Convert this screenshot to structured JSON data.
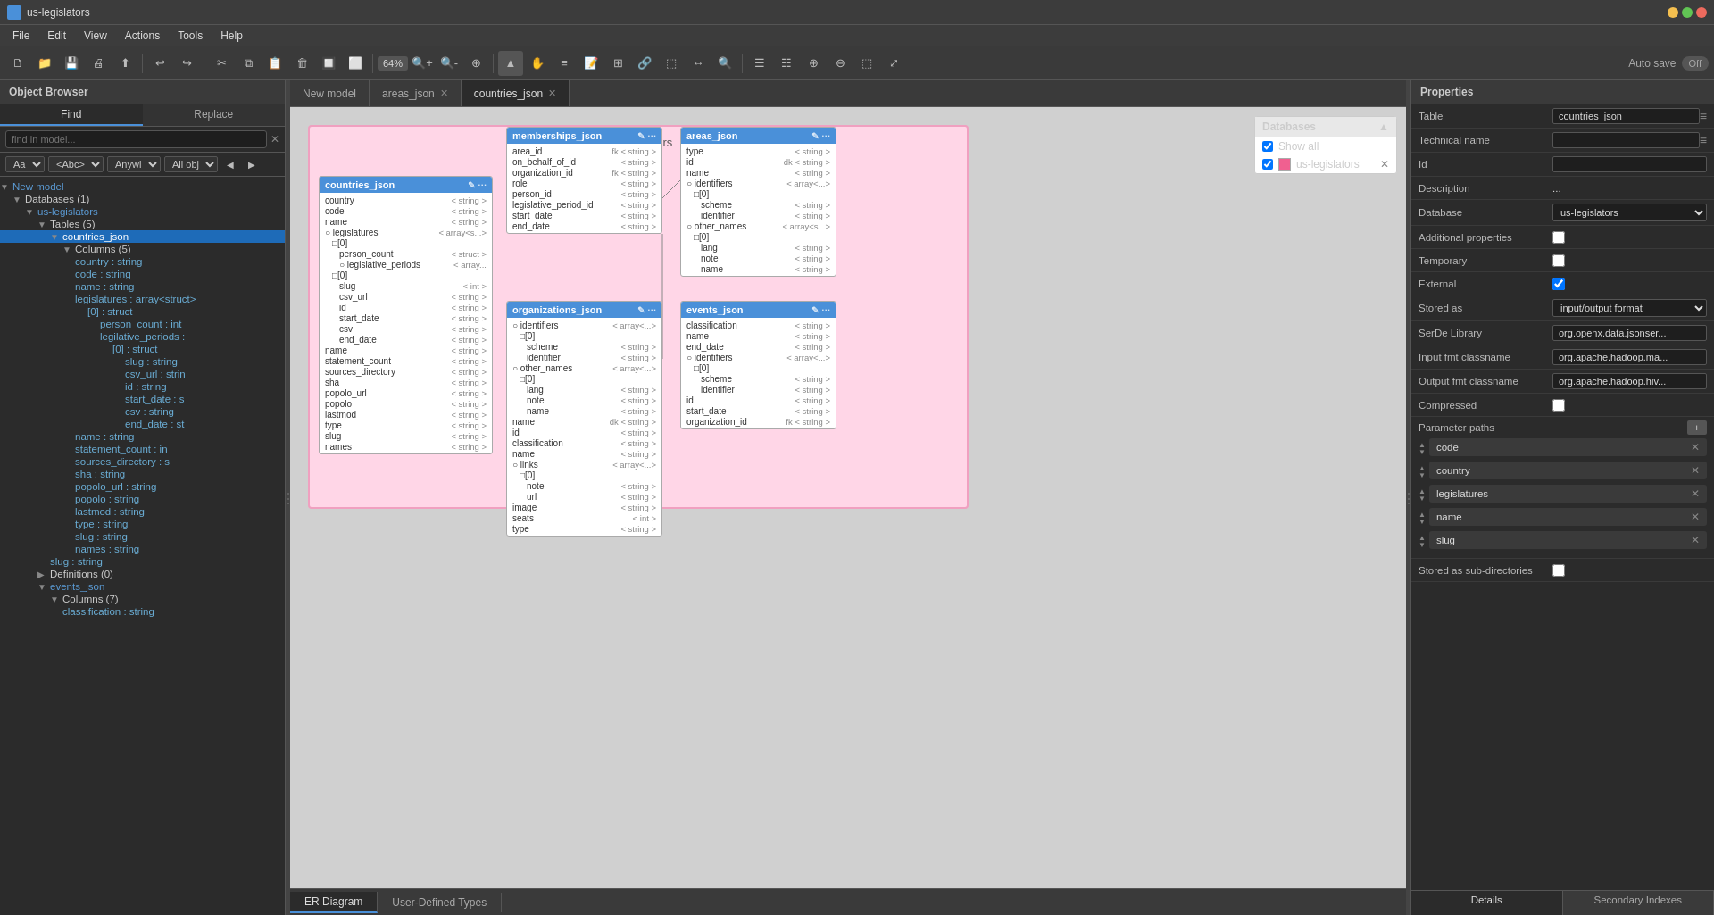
{
  "titlebar": {
    "title": "us-legislators"
  },
  "menubar": {
    "items": [
      "File",
      "Edit",
      "View",
      "Actions",
      "Tools",
      "Help"
    ]
  },
  "toolbar": {
    "zoom": "64%",
    "autosave_label": "Auto save",
    "toggle_label": "Off"
  },
  "left_panel": {
    "title": "Object Browser",
    "find_tab": "Find",
    "replace_tab": "Replace",
    "search_placeholder": "find in model...",
    "filter_case": "Aa",
    "filter_abc": "<Abc>",
    "filter_anywl": "Anywl ▼",
    "filter_allobj": "All obj ▼",
    "tree": {
      "new_model": "New model",
      "databases": "Databases (1)",
      "us_legislators": "us-legislators",
      "tables": "Tables (5)",
      "countries_json": "countries_json",
      "columns": "Columns (5)",
      "cols": [
        "country : string",
        "code : string",
        "name : string",
        "legislatures : array<struct>",
        "[0] : struct",
        "person_count : int",
        "legilative_periods :",
        "[0] : struct",
        "slug : string",
        "csv_url : strin",
        "id : string",
        "start_date : s",
        "csv : string",
        "end_date : st",
        "name : string",
        "statement_count : in",
        "sources_directory : s",
        "sha : string",
        "popolo_url : string",
        "popolo : string",
        "lastmod : string",
        "type : string",
        "slug : string",
        "names : string"
      ],
      "slug_string": "slug : string",
      "definitions": "Definitions (0)",
      "events_json": "events_json",
      "events_cols": "Columns (7)",
      "classification_string": "classification : string"
    }
  },
  "tabs": [
    {
      "label": "New model",
      "active": false,
      "closable": false
    },
    {
      "label": "areas_json",
      "active": false,
      "closable": true
    },
    {
      "label": "countries_json",
      "active": true,
      "closable": true
    }
  ],
  "canvas": {
    "schema_title": "us-legislators",
    "tables": {
      "countries_json": {
        "title": "countries_json",
        "rows": [
          {
            "name": "country",
            "type": "< string >"
          },
          {
            "name": "code",
            "type": "< string >"
          },
          {
            "name": "name",
            "type": "< string >"
          },
          {
            "name": "○ legislatures",
            "type": "< array<s...>"
          },
          {
            "name": "  □[0]",
            "type": ""
          },
          {
            "name": "    person_count",
            "type": "< struct >"
          },
          {
            "name": "    ○ legislative_periods",
            "type": "< array<...>"
          },
          {
            "name": "      □[0]",
            "type": ""
          },
          {
            "name": "        slug",
            "type": "< int >"
          },
          {
            "name": "        csv_url",
            "type": "< string >"
          },
          {
            "name": "        id",
            "type": "< string >"
          },
          {
            "name": "        start_date",
            "type": "< string >"
          },
          {
            "name": "        csv",
            "type": "< string >"
          },
          {
            "name": "        end_date",
            "type": "< string >"
          },
          {
            "name": "name",
            "type": "< string >"
          },
          {
            "name": "statement_count",
            "type": "< string >"
          },
          {
            "name": "sources_directory",
            "type": "< string >"
          },
          {
            "name": "sha",
            "type": "< string >"
          },
          {
            "name": "popolo_url",
            "type": "< string >"
          },
          {
            "name": "popolo",
            "type": "< string >"
          },
          {
            "name": "lastmod",
            "type": "< string >"
          },
          {
            "name": "type",
            "type": "< string >"
          },
          {
            "name": "slug",
            "type": "< string >"
          },
          {
            "name": "names",
            "type": "< string >"
          }
        ]
      },
      "memberships_json": {
        "title": "memberships_json",
        "rows": [
          {
            "name": "area_id",
            "type": "fk  < string >"
          },
          {
            "name": "on_behalf_of_id",
            "type": "< string >"
          },
          {
            "name": "organization_id",
            "type": "fk  < string >"
          },
          {
            "name": "role",
            "type": "< string >"
          },
          {
            "name": "person_id",
            "type": "< string >"
          },
          {
            "name": "legislative_period_id",
            "type": "< string >"
          },
          {
            "name": "start_date",
            "type": "< string >"
          },
          {
            "name": "end_date",
            "type": "< string >"
          }
        ]
      },
      "areas_json": {
        "title": "areas_json",
        "rows": [
          {
            "name": "type",
            "type": "< string >"
          },
          {
            "name": "id",
            "type": "dk  < string >"
          },
          {
            "name": "name",
            "type": "< string >"
          },
          {
            "name": "○ identifiers",
            "type": "< array<...>"
          },
          {
            "name": "  □[0]",
            "type": ""
          },
          {
            "name": "    scheme",
            "type": "< string >"
          },
          {
            "name": "    identifier",
            "type": "< string >"
          },
          {
            "name": "○ other_names",
            "type": "< array<s...>"
          },
          {
            "name": "  □[0]",
            "type": ""
          },
          {
            "name": "    lang",
            "type": "< string >"
          },
          {
            "name": "    note",
            "type": "< string >"
          },
          {
            "name": "    name",
            "type": "< string >"
          }
        ]
      },
      "organizations_json": {
        "title": "organizations_json",
        "rows": [
          {
            "name": "○ identifiers",
            "type": "< array<...>"
          },
          {
            "name": "  □[0]",
            "type": ""
          },
          {
            "name": "    scheme",
            "type": "< string >"
          },
          {
            "name": "    identifier",
            "type": "< string >"
          },
          {
            "name": "○ other_names",
            "type": "< array<...>"
          },
          {
            "name": "  □[0]",
            "type": ""
          },
          {
            "name": "    lang",
            "type": "< string >"
          },
          {
            "name": "    note",
            "type": "< string >"
          },
          {
            "name": "    name",
            "type": "< string >"
          },
          {
            "name": "name",
            "type": "dk  < string >"
          },
          {
            "name": "id",
            "type": "< string >"
          },
          {
            "name": "classification",
            "type": "< string >"
          },
          {
            "name": "name",
            "type": "< string >"
          },
          {
            "name": "○ links",
            "type": "< array<...>"
          },
          {
            "name": "  □[0]",
            "type": ""
          },
          {
            "name": "    note",
            "type": "< string >"
          },
          {
            "name": "    url",
            "type": "< string >"
          },
          {
            "name": "image",
            "type": "< string >"
          },
          {
            "name": "seats",
            "type": "< int >"
          },
          {
            "name": "type",
            "type": "< string >"
          }
        ]
      },
      "events_json": {
        "title": "events_json",
        "rows": [
          {
            "name": "classification",
            "type": "< string >"
          },
          {
            "name": "name",
            "type": "< string >"
          },
          {
            "name": "end_date",
            "type": "< string >"
          },
          {
            "name": "○ identifiers",
            "type": "< array<...>"
          },
          {
            "name": "  □[0]",
            "type": ""
          },
          {
            "name": "    scheme",
            "type": "< string >"
          },
          {
            "name": "    identifier",
            "type": "< string >"
          },
          {
            "name": "id",
            "type": "< string >"
          },
          {
            "name": "start_date",
            "type": "< string >"
          },
          {
            "name": "organization_id",
            "type": "fk  < string >"
          }
        ]
      }
    },
    "bottom_tabs": [
      "ER Diagram",
      "User-Defined Types"
    ]
  },
  "databases_panel": {
    "title": "Databases",
    "show_all": "Show all",
    "items": [
      {
        "label": "us-legislators",
        "color": "#f06090",
        "checked": true
      }
    ]
  },
  "properties": {
    "title": "Properties",
    "fields": [
      {
        "label": "Table",
        "value": "countries_json",
        "type": "input"
      },
      {
        "label": "Technical name",
        "value": "",
        "type": "input"
      },
      {
        "label": "Id",
        "value": "",
        "type": "input"
      },
      {
        "label": "Description",
        "value": "...",
        "type": "text"
      },
      {
        "label": "Database",
        "value": "us-legislators",
        "type": "select"
      },
      {
        "label": "Additional properties",
        "value": "",
        "type": "checkbox",
        "checked": false
      },
      {
        "label": "Temporary",
        "value": "",
        "type": "checkbox",
        "checked": false
      },
      {
        "label": "External",
        "value": "",
        "type": "checkbox",
        "checked": true
      },
      {
        "label": "Stored as",
        "value": "input/output format",
        "type": "select"
      },
      {
        "label": "SerDe Library",
        "value": "org.openx.data.jsonser...",
        "type": "input"
      },
      {
        "label": "Input fmt classname",
        "value": "org.apache.hadoop.ma...",
        "type": "input"
      },
      {
        "label": "Output fmt classname",
        "value": "org.apache.hadoop.hiv...",
        "type": "input"
      },
      {
        "label": "Compressed",
        "value": "",
        "type": "checkbox",
        "checked": false
      }
    ],
    "param_paths_label": "Parameter paths",
    "param_paths": [
      "code",
      "country",
      "legislatures",
      "name",
      "slug"
    ],
    "stored_as_subdirectories_label": "Stored as sub-directories",
    "stored_as_subdirectories_checked": false,
    "bottom_tabs": [
      "Details",
      "Secondary Indexes"
    ]
  }
}
